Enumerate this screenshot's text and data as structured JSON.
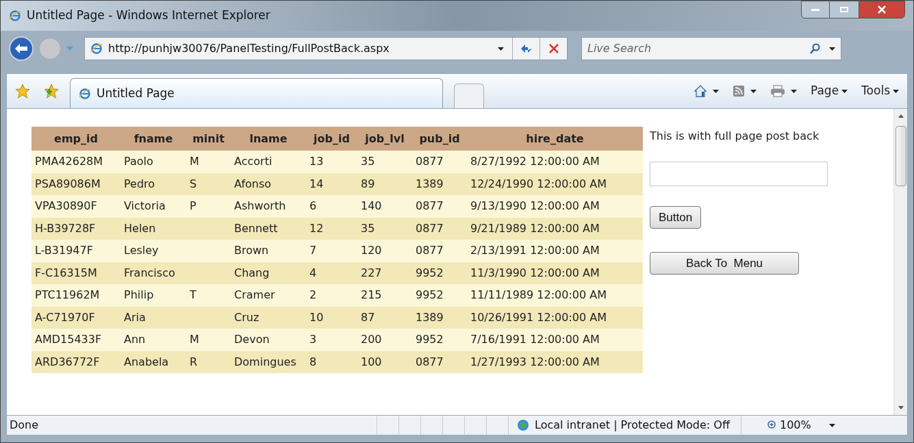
{
  "window": {
    "title": "Untitled Page - Windows Internet Explorer"
  },
  "address_bar": {
    "url": "http://punhjw30076/PanelTesting/FullPostBack.aspx"
  },
  "search": {
    "placeholder": "Live Search"
  },
  "tabs": [
    {
      "label": "Untitled Page",
      "selected": true
    }
  ],
  "command_bar": [
    {
      "kind": "home"
    },
    {
      "kind": "feeds"
    },
    {
      "kind": "print"
    },
    {
      "kind": "menu",
      "label": "Page"
    },
    {
      "kind": "menu",
      "label": "Tools"
    }
  ],
  "table": {
    "columns": [
      "emp_id",
      "fname",
      "minit",
      "lname",
      "job_id",
      "job_lvl",
      "pub_id",
      "hire_date"
    ],
    "rows": [
      [
        "PMA42628M",
        "Paolo",
        "M",
        "Accorti",
        "13",
        "35",
        "0877",
        "8/27/1992 12:00:00 AM"
      ],
      [
        "PSA89086M",
        "Pedro",
        "S",
        "Afonso",
        "14",
        "89",
        "1389",
        "12/24/1990 12:00:00 AM"
      ],
      [
        "VPA30890F",
        "Victoria",
        "P",
        "Ashworth",
        "6",
        "140",
        "0877",
        "9/13/1990 12:00:00 AM"
      ],
      [
        "H-B39728F",
        "Helen",
        "",
        "Bennett",
        "12",
        "35",
        "0877",
        "9/21/1989 12:00:00 AM"
      ],
      [
        "L-B31947F",
        "Lesley",
        "",
        "Brown",
        "7",
        "120",
        "0877",
        "2/13/1991 12:00:00 AM"
      ],
      [
        "F-C16315M",
        "Francisco",
        "",
        "Chang",
        "4",
        "227",
        "9952",
        "11/3/1990 12:00:00 AM"
      ],
      [
        "PTC11962M",
        "Philip",
        "T",
        "Cramer",
        "2",
        "215",
        "9952",
        "11/11/1989 12:00:00 AM"
      ],
      [
        "A-C71970F",
        "Aria",
        "",
        "Cruz",
        "10",
        "87",
        "1389",
        "10/26/1991 12:00:00 AM"
      ],
      [
        "AMD15433F",
        "Ann",
        "M",
        "Devon",
        "3",
        "200",
        "9952",
        "7/16/1991 12:00:00 AM"
      ],
      [
        "ARD36772F",
        "Anabela",
        "R",
        "Domingues",
        "8",
        "100",
        "0877",
        "1/27/1993 12:00:00 AM"
      ]
    ]
  },
  "side_panel": {
    "text": "This is with full page post back",
    "buttons": [
      "Button",
      "Back To  Menu"
    ]
  },
  "status_bar": {
    "text": "Done",
    "zone": "Local intranet | Protected Mode: Off",
    "zoom": "100%"
  }
}
